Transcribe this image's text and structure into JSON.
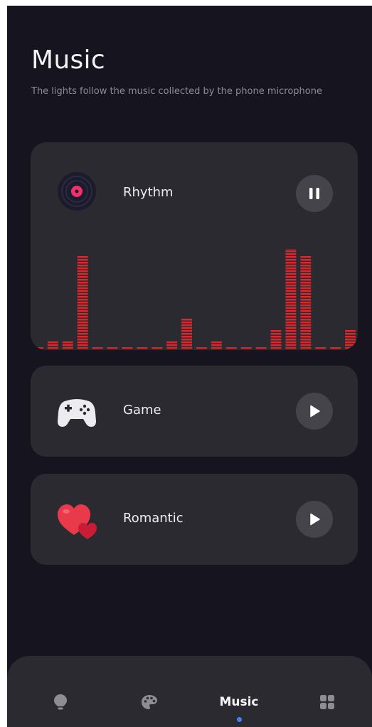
{
  "page": {
    "title": "Music",
    "subtitle": "The lights follow the music collected by the phone microphone"
  },
  "modes": [
    {
      "label": "Rhythm",
      "icon": "vinyl-record-icon",
      "control": "pause-icon",
      "state": "playing"
    },
    {
      "label": "Game",
      "icon": "gamepad-icon",
      "control": "play-icon",
      "state": "stopped"
    },
    {
      "label": "Romantic",
      "icon": "hearts-icon",
      "control": "play-icon",
      "state": "stopped"
    }
  ],
  "equalizer": {
    "color": "#e0262b",
    "levels": [
      0,
      1,
      1,
      16,
      0,
      0,
      0,
      0,
      0,
      1,
      5,
      0,
      1,
      0,
      0,
      0,
      3,
      19,
      16,
      0,
      0,
      3
    ]
  },
  "nav": {
    "items": [
      {
        "label": "",
        "icon": "lightbulb-icon",
        "active": false
      },
      {
        "label": "",
        "icon": "palette-icon",
        "active": false
      },
      {
        "label": "Music",
        "icon": "",
        "active": true
      },
      {
        "label": "",
        "icon": "grid-icon",
        "active": false
      }
    ],
    "accent": "#3a86f5"
  },
  "colors": {
    "background": "#16141e",
    "card": "#2b2a31",
    "button": "#45444b"
  }
}
